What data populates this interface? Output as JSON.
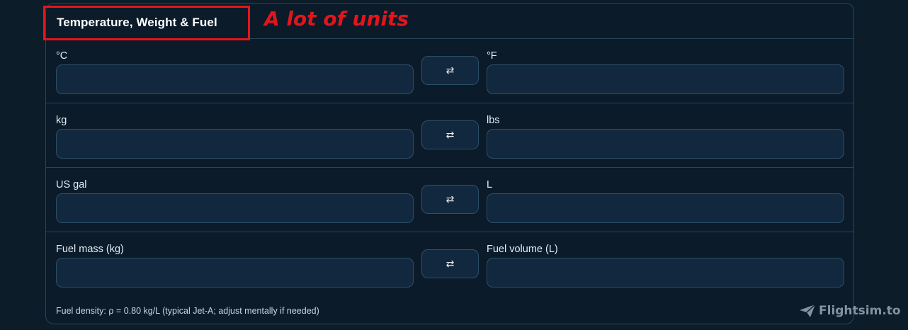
{
  "section": {
    "title": "Temperature, Weight & Fuel"
  },
  "rows": [
    {
      "left_label": "°C",
      "right_label": "°F",
      "left_value": "",
      "right_value": "",
      "swap_label": "⇄"
    },
    {
      "left_label": "kg",
      "right_label": "lbs",
      "left_value": "",
      "right_value": "",
      "swap_label": "⇄"
    },
    {
      "left_label": "US gal",
      "right_label": "L",
      "left_value": "",
      "right_value": "",
      "swap_label": "⇄"
    },
    {
      "left_label": "Fuel mass (kg)",
      "right_label": "Fuel volume (L)",
      "left_value": "",
      "right_value": "",
      "swap_label": "⇄"
    }
  ],
  "footnote": "Fuel density: ρ = 0.80 kg/L (typical Jet-A; adjust mentally if needed)",
  "annotation": {
    "text": "A lot of units",
    "color": "#e3151b"
  },
  "watermark": {
    "text": "Flightsim.to",
    "icon": "paper-plane-icon"
  },
  "colors": {
    "background": "#0c1c28",
    "panel": "#0b1b2a",
    "input": "#12283f",
    "border": "#2c5069"
  }
}
